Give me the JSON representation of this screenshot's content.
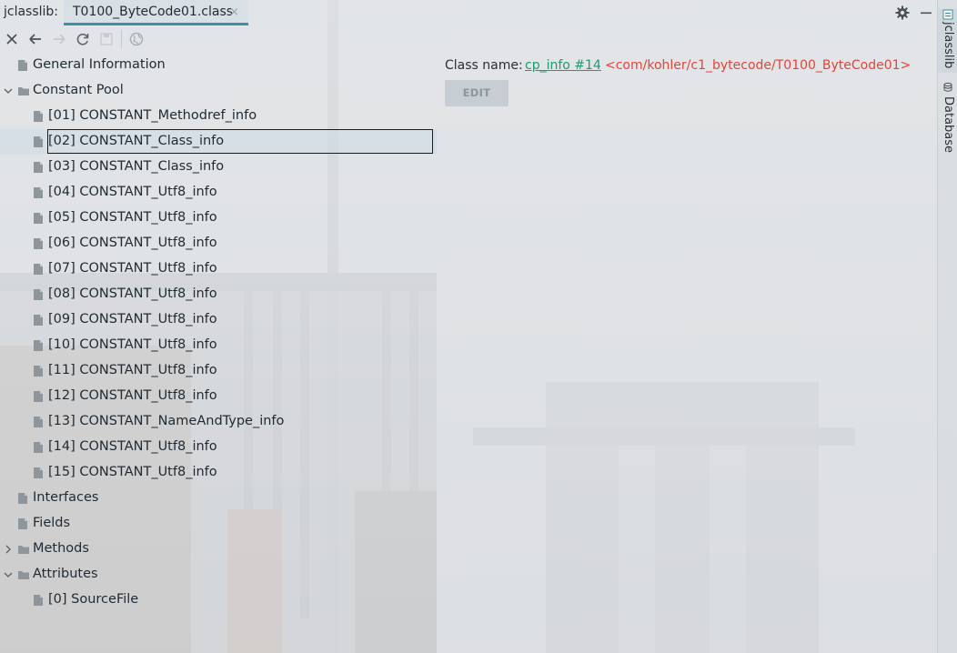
{
  "header": {
    "tool_title": "jclasslib:",
    "file_tab": "T0100_ByteCode01.class",
    "tab_close_glyph": "×"
  },
  "toolbar": {
    "buttons": [
      "close-icon",
      "back-arrow-icon",
      "forward-arrow-icon",
      "refresh-icon",
      "save-icon",
      "web-icon"
    ]
  },
  "tree": {
    "items": [
      {
        "label": "General Information",
        "level": 0,
        "expandable": false
      },
      {
        "label": "Constant Pool",
        "level": 0,
        "expandable": true,
        "expanded": true
      },
      {
        "label": "[01] CONSTANT_Methodref_info",
        "level": 1
      },
      {
        "label": "[02] CONSTANT_Class_info",
        "level": 1,
        "selected": true
      },
      {
        "label": "[03] CONSTANT_Class_info",
        "level": 1
      },
      {
        "label": "[04] CONSTANT_Utf8_info",
        "level": 1
      },
      {
        "label": "[05] CONSTANT_Utf8_info",
        "level": 1
      },
      {
        "label": "[06] CONSTANT_Utf8_info",
        "level": 1
      },
      {
        "label": "[07] CONSTANT_Utf8_info",
        "level": 1
      },
      {
        "label": "[08] CONSTANT_Utf8_info",
        "level": 1
      },
      {
        "label": "[09] CONSTANT_Utf8_info",
        "level": 1
      },
      {
        "label": "[10] CONSTANT_Utf8_info",
        "level": 1
      },
      {
        "label": "[11] CONSTANT_Utf8_info",
        "level": 1
      },
      {
        "label": "[12] CONSTANT_Utf8_info",
        "level": 1
      },
      {
        "label": "[13] CONSTANT_NameAndType_info",
        "level": 1
      },
      {
        "label": "[14] CONSTANT_Utf8_info",
        "level": 1
      },
      {
        "label": "[15] CONSTANT_Utf8_info",
        "level": 1
      },
      {
        "label": "Interfaces",
        "level": 0,
        "expandable": false
      },
      {
        "label": "Fields",
        "level": 0,
        "expandable": false
      },
      {
        "label": "Methods",
        "level": 0,
        "expandable": true,
        "expanded": false
      },
      {
        "label": "Attributes",
        "level": 0,
        "expandable": true,
        "expanded": true
      },
      {
        "label": "[0] SourceFile",
        "level": 1
      }
    ]
  },
  "detail": {
    "class_name_label": "Class name:",
    "cp_link": "cp_info #14",
    "cp_value": "<com/kohler/c1_bytecode/T0100_ByteCode01>",
    "edit_button": "EDIT"
  },
  "side_tabs": {
    "jclasslib": "jclasslib",
    "database": "Database"
  },
  "colors": {
    "tab_accent": "#3f8fa8",
    "link": "#1f9a73",
    "value_red": "#e0443a"
  }
}
